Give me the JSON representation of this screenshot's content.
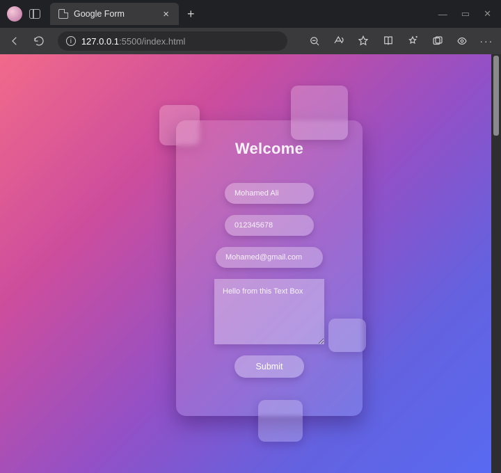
{
  "browser": {
    "tab_title": "Google Form",
    "address_host": "127.0.0.1",
    "address_rest": ":5500/index.html",
    "new_tab_label": "+",
    "window_controls": {
      "minimize": "—",
      "maximize": "▭",
      "close": "✕"
    }
  },
  "form": {
    "heading": "Welcome",
    "name_placeholder": "Mohamed Ali",
    "phone_placeholder": "012345678",
    "email_placeholder": "Mohamed@gmail.com",
    "message_placeholder": "Hello from this Text Box",
    "submit_label": "Submit"
  }
}
